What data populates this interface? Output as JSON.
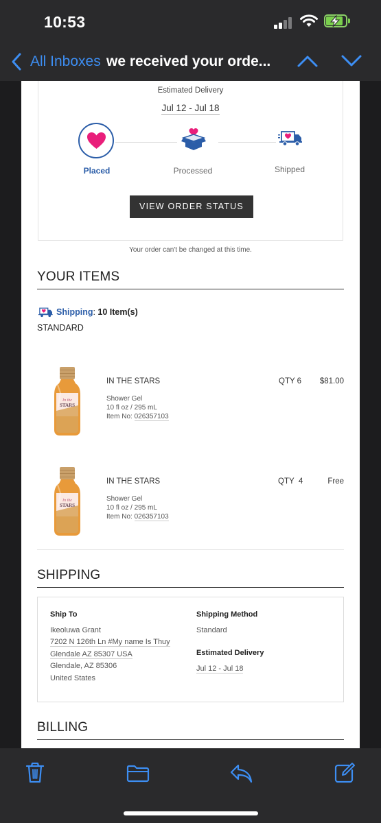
{
  "status_bar": {
    "time": "10:53",
    "battery_color": "#7ad04d"
  },
  "nav": {
    "back_label": "All Inboxes",
    "subject": "we received your orde...",
    "accent": "#3d8ef3",
    "icons": [
      "chevron-left-icon",
      "chevron-up-icon",
      "chevron-down-icon"
    ]
  },
  "order": {
    "estimated_label": "Estimated Delivery",
    "estimated_dates": "Jul 12 - Jul 18",
    "steps": [
      {
        "label": "Placed",
        "icon": "heart-icon",
        "active": true
      },
      {
        "label": "Processed",
        "icon": "box-heart-icon",
        "active": false
      },
      {
        "label": "Shipped",
        "icon": "truck-icon",
        "active": false
      }
    ],
    "view_button": "VIEW ORDER STATUS",
    "cant_change": "Your order can't be changed at this time.",
    "brand_blue": "#2b5da8",
    "heart_pink": "#e91e7a"
  },
  "items_section": {
    "title": "YOUR ITEMS",
    "shipping_word": "Shipping",
    "shipping_sep": ": ",
    "shipping_count": "10 Item(s)",
    "method": "STANDARD",
    "items": [
      {
        "name": "IN THE STARS",
        "type": "Shower Gel",
        "size": "10 fl oz / 295 mL",
        "item_no_label": "Item No: ",
        "item_no": "026357103",
        "qty": "QTY 6",
        "price": "$81.00"
      },
      {
        "name": "IN THE STARS",
        "type": "Shower Gel",
        "size": "10 fl oz / 295 mL",
        "item_no_label": "Item No: ",
        "item_no": "026357103",
        "qty": "QTY  4",
        "price": "Free"
      }
    ]
  },
  "shipping_section": {
    "title": "SHIPPING",
    "ship_to_label": "Ship To",
    "ship_to": {
      "name": "Ikeoluwa Grant",
      "address1": "7202 N 126th Ln #My name Is Thuy",
      "address2": "Glendale AZ 85307 USA",
      "city": "Glendale, AZ 85306",
      "country": "United States"
    },
    "method_label": "Shipping Method",
    "method_value": "Standard",
    "delivery_label": "Estimated Delivery",
    "delivery_value": "Jul 12 - Jul 18"
  },
  "billing_section": {
    "title": "BILLING"
  },
  "toolbar": {
    "icons": [
      "trash-icon",
      "folder-icon",
      "reply-icon",
      "compose-icon"
    ],
    "accent": "#3d8ef3"
  }
}
